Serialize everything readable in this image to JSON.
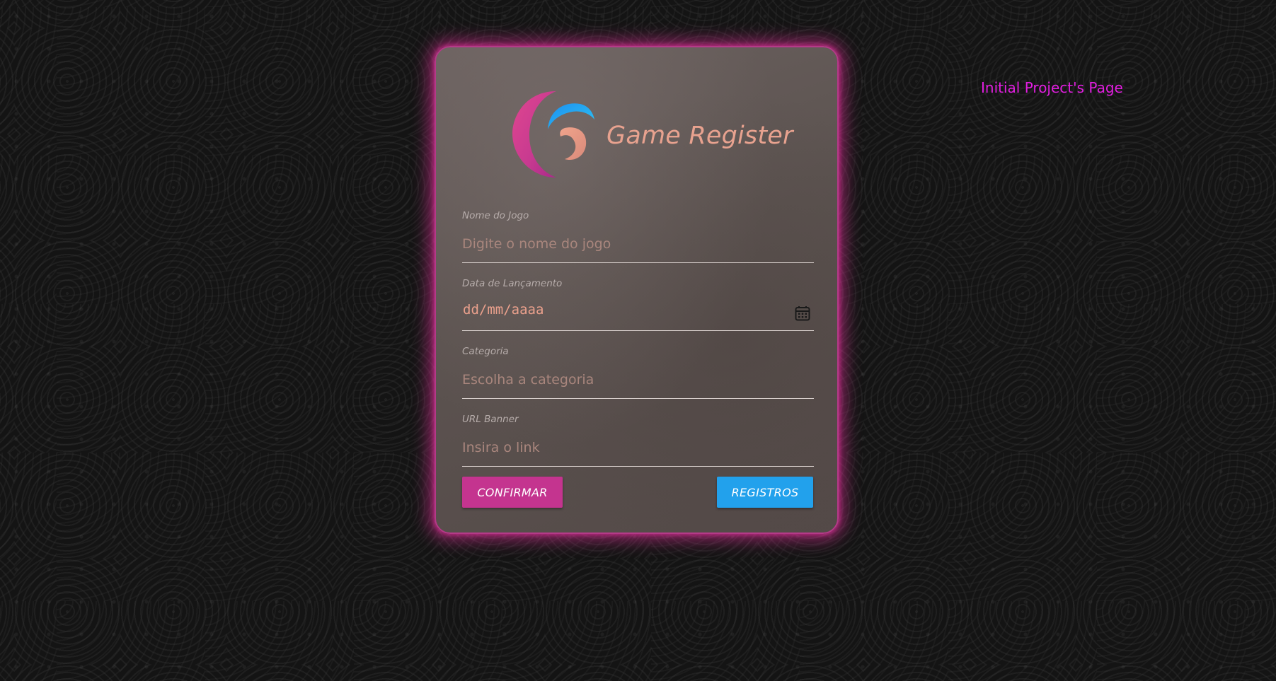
{
  "header": {
    "link_label": "Initial Project's Page"
  },
  "brand": {
    "title": "Game Register",
    "logo_icon": "crescent-swirl-logo"
  },
  "form": {
    "fields": [
      {
        "label": "Nome do Jogo",
        "placeholder": "Digite o nome do jogo",
        "value": ""
      },
      {
        "label": "Data de Lançamento",
        "value": "dd/mm/aaaa",
        "icon": "calendar-icon"
      },
      {
        "label": "Categoria",
        "placeholder": "Escolha a categoria",
        "value": ""
      },
      {
        "label": "URL Banner",
        "placeholder": "Insira o link",
        "value": ""
      }
    ],
    "confirm_label": "CONFIRMAR",
    "records_label": "REGISTROS"
  },
  "colors": {
    "accent_pink": "#c4348f",
    "accent_blue": "#22a1ec",
    "title_salmon": "#e8a28f",
    "link_magenta": "#e21ee0",
    "card_glow": "#db2f96"
  }
}
